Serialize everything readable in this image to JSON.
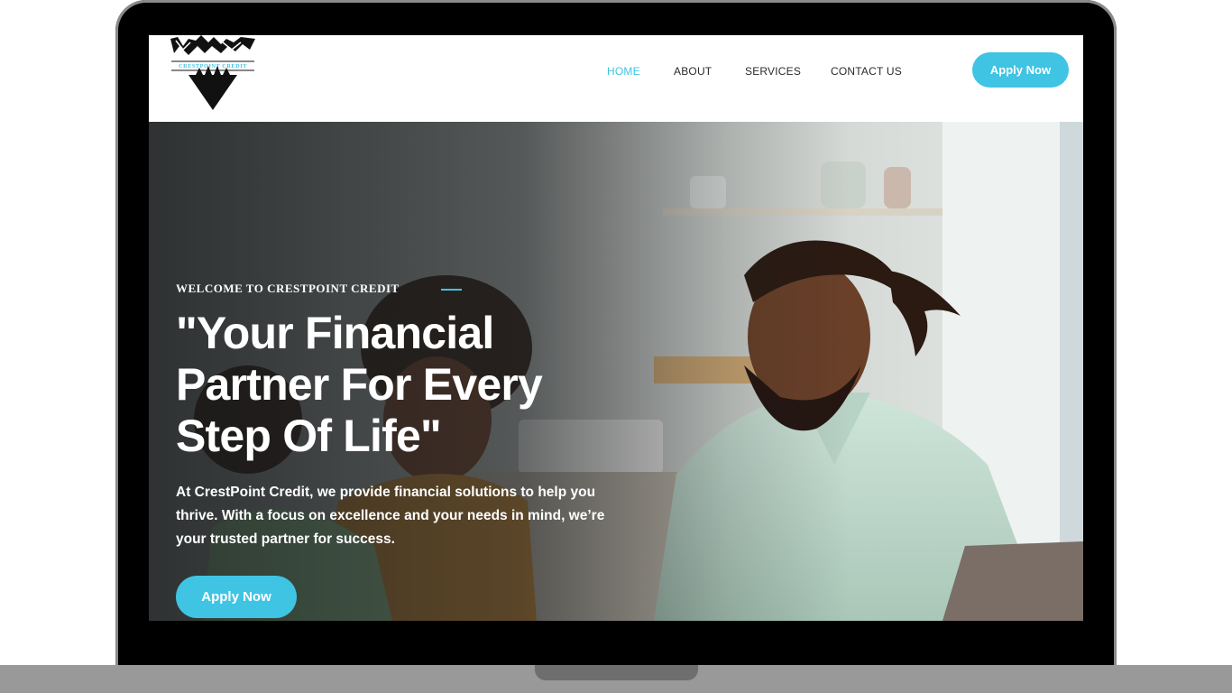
{
  "logo": {
    "icon": "mountain-logo-icon",
    "wordmark": "CRESTPOINT CREDIT"
  },
  "nav": {
    "items": [
      {
        "label": "HOME",
        "active": true
      },
      {
        "label": "ABOUT",
        "active": false
      },
      {
        "label": "SERVICES",
        "active": false
      },
      {
        "label": "CONTACT US",
        "active": false
      }
    ]
  },
  "header": {
    "apply_label": "Apply Now"
  },
  "hero": {
    "eyebrow": "WELCOME TO CRESTPOINT CREDIT",
    "headline": "\"Your Financial Partner For Every Step Of Life\"",
    "lede": "At CrestPoint Credit, we provide financial solutions to help you thrive. With a focus on excellence and your needs in mind, we’re your trusted partner for success.",
    "apply_label": "Apply Now"
  },
  "colors": {
    "accent": "#3fc4e4",
    "nav_text": "#2a2a2a",
    "laptop_frame": "#000000",
    "laptop_base": "#999999"
  }
}
